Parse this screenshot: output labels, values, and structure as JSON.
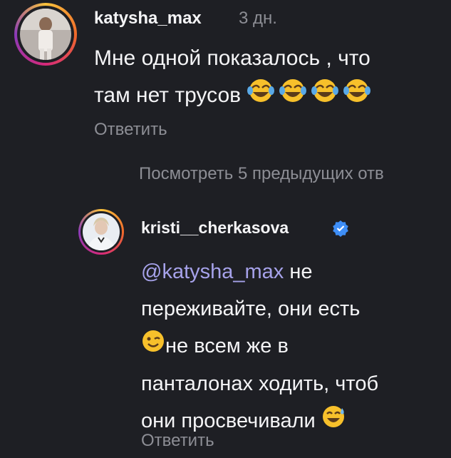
{
  "comment1": {
    "username": "katysha_max",
    "time": "3 дн.",
    "text_line1": "Мне одной показалось , что",
    "text_line2": "там нет трусов",
    "emoji": "laughing-tears-emoji",
    "reply": "Ответить"
  },
  "view_more": "Посмотреть 5 предыдущих отв",
  "comment2": {
    "username": "kristi__cherkasova",
    "verified_icon": "verified-badge-icon",
    "mention": "@katysha_max",
    "line1_rest": " не",
    "line2": "переживайте, они есть",
    "line3": "не всем же в",
    "line4": "панталонах ходить, чтоб",
    "line5": "они просвечивали",
    "reply": "Ответить"
  },
  "colors": {
    "background": "#1e1f24",
    "mention": "#a6a2ea",
    "verified": "#3e8ef7",
    "muted": "#8d8e95"
  }
}
